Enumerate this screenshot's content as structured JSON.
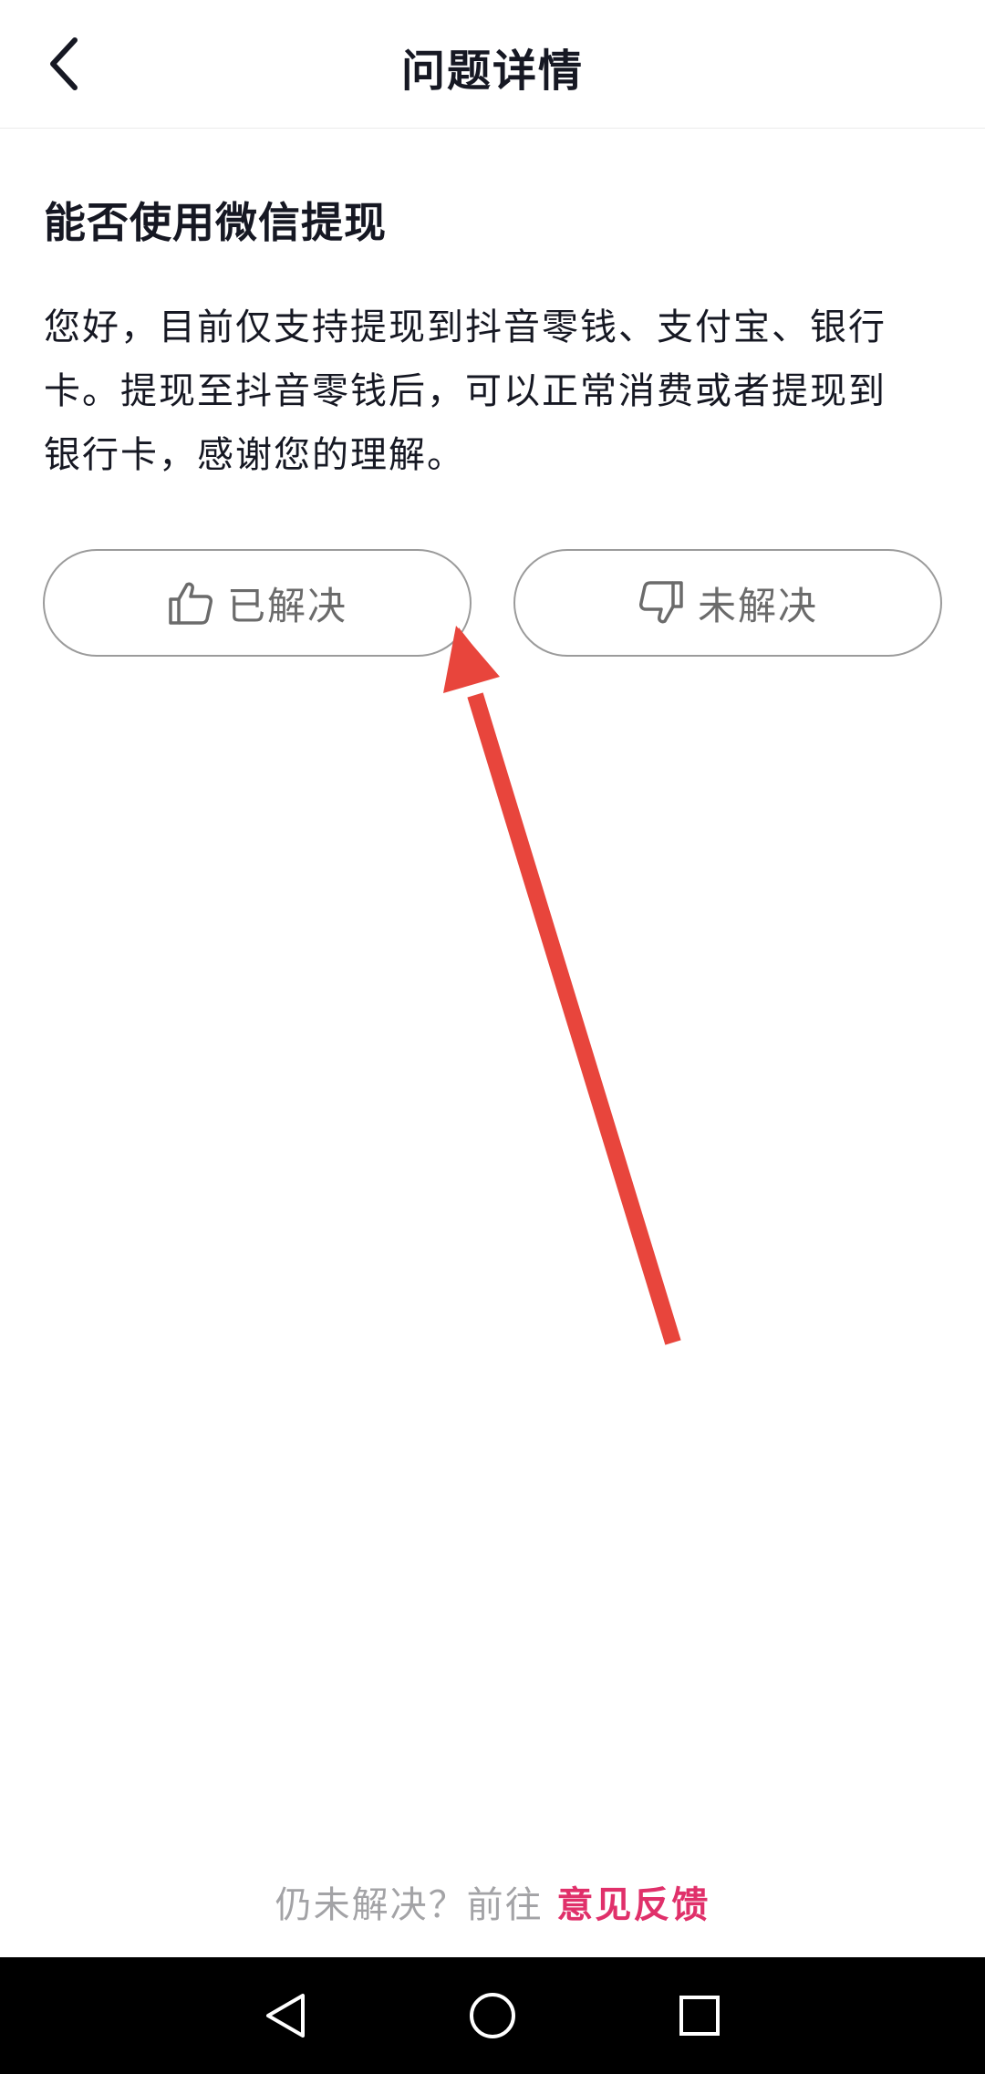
{
  "header": {
    "title": "问题详情",
    "back_icon": "chevron-left-icon"
  },
  "question": {
    "title": "能否使用微信提现",
    "answer": "您好，目前仅支持提现到抖音零钱、支付宝、银行卡。提现至抖音零钱后，可以正常消费或者提现到银行卡，感谢您的理解。"
  },
  "feedback": {
    "resolved_label": "已解决",
    "resolved_icon": "thumbs-up-icon",
    "unresolved_label": "未解决",
    "unresolved_icon": "thumbs-down-icon"
  },
  "footer": {
    "prefix": "仍未解决？前往 ",
    "link_label": "意见反馈",
    "link_color": "#e0306a"
  },
  "nav_bar": {
    "back_icon": "triangle-back-icon",
    "home_icon": "circle-home-icon",
    "recents_icon": "square-recents-icon"
  },
  "colors": {
    "text_primary": "#161823",
    "button_border": "#9b9b9b",
    "button_text": "#6b6b6b",
    "annotation_arrow": "#e8453c"
  }
}
